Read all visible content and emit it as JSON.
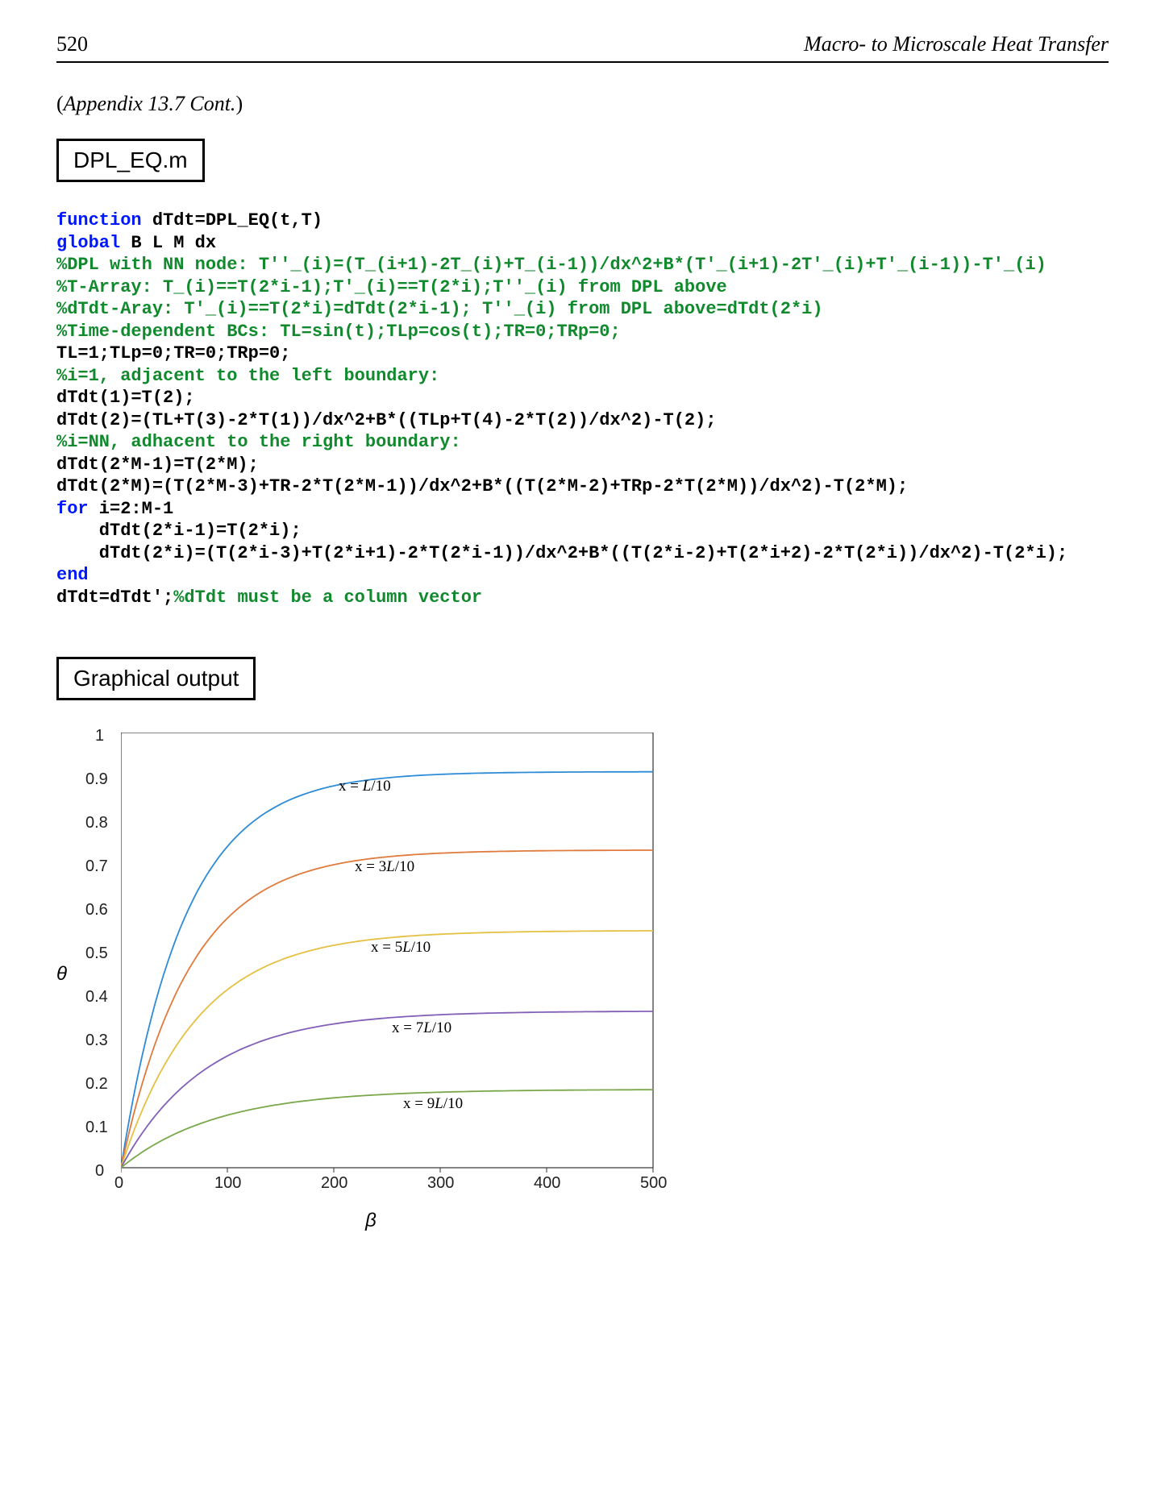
{
  "header": {
    "page_number": "520",
    "book_title": "Macro- to Microscale Heat Transfer"
  },
  "appendix_line": {
    "open": "(",
    "text": "Appendix 13.7 Cont.",
    "close": ")"
  },
  "filename": "DPL_EQ.m",
  "code": {
    "l1a": "function",
    "l1b": " dTdt=DPL_EQ(t,T)",
    "l2a": "global",
    "l2b": " B L M dx",
    "l3": "%DPL with NN node: T''_(i)=(T_(i+1)-2T_(i)+T_(i-1))/dx^2+B*(T'_(i+1)-2T'_(i)+T'_(i-1))-T'_(i)",
    "l4": "%T-Array: T_(i)==T(2*i-1);T'_(i)==T(2*i);T''_(i) from DPL above",
    "l5": "%dTdt-Aray: T'_(i)==T(2*i)=dTdt(2*i-1); T''_(i) from DPL above=dTdt(2*i)",
    "l6": "%Time-dependent BCs: TL=sin(t);TLp=cos(t);TR=0;TRp=0;",
    "l7": "TL=1;TLp=0;TR=0;TRp=0;",
    "l8": "%i=1, adjacent to the left boundary:",
    "l9": "dTdt(1)=T(2);",
    "l10": "dTdt(2)=(TL+T(3)-2*T(1))/dx^2+B*((TLp+T(4)-2*T(2))/dx^2)-T(2);",
    "l11": "%i=NN, adhacent to the right boundary:",
    "l12": "dTdt(2*M-1)=T(2*M);",
    "l13": "dTdt(2*M)=(T(2*M-3)+TR-2*T(2*M-1))/dx^2+B*((T(2*M-2)+TRp-2*T(2*M))/dx^2)-T(2*M);",
    "l14a": "for",
    "l14b": " i=2:M-1",
    "l15": "    dTdt(2*i-1)=T(2*i);",
    "l16": "    dTdt(2*i)=(T(2*i-3)+T(2*i+1)-2*T(2*i-1))/dx^2+B*((T(2*i-2)+T(2*i+2)-2*T(2*i))/dx^2)-T(2*i);",
    "l17": "end",
    "l18a": "dTdt=dTdt';",
    "l18b": "%dTdt must be a column vector"
  },
  "graph_label": "Graphical output",
  "chart_data": {
    "type": "line",
    "xlabel": "β",
    "ylabel": "θ",
    "xlim": [
      0,
      500
    ],
    "ylim": [
      0,
      1
    ],
    "xticks": [
      0,
      100,
      200,
      300,
      400,
      500
    ],
    "yticks": [
      0,
      0.1,
      0.2,
      0.3,
      0.4,
      0.5,
      0.6,
      0.7,
      0.8,
      0.9,
      1
    ],
    "series": [
      {
        "name": "x = L/10",
        "color": "#2e8bd6",
        "asymptote": 0.91,
        "rise": 60
      },
      {
        "name": "x = 3L/10",
        "color": "#e07a3d",
        "asymptote": 0.73,
        "rise": 65
      },
      {
        "name": "x = 5L/10",
        "color": "#e4c043",
        "asymptote": 0.545,
        "rise": 72
      },
      {
        "name": "x = 7L/10",
        "color": "#8260b8",
        "asymptote": 0.36,
        "rise": 80
      },
      {
        "name": "x = 9L/10",
        "color": "#7aa84b",
        "asymptote": 0.18,
        "rise": 90
      }
    ],
    "series_labels": {
      "s0": {
        "prefix": "x = ",
        "L": "L",
        "suffix": "/10"
      },
      "s1": {
        "prefix": "x = 3",
        "L": "L",
        "suffix": "/10"
      },
      "s2": {
        "prefix": "x = 5",
        "L": "L",
        "suffix": "/10"
      },
      "s3": {
        "prefix": "x = 7",
        "L": "L",
        "suffix": "/10"
      },
      "s4": {
        "prefix": "x = 9",
        "L": "L",
        "suffix": "/10"
      }
    },
    "tick_text": {
      "x0": "0",
      "x1": "100",
      "x2": "200",
      "x3": "300",
      "x4": "400",
      "x5": "500",
      "y0": "0",
      "y1": "0.1",
      "y2": "0.2",
      "y3": "0.3",
      "y4": "0.4",
      "y5": "0.5",
      "y6": "0.6",
      "y7": "0.7",
      "y8": "0.8",
      "y9": "0.9",
      "y10": "1"
    }
  }
}
